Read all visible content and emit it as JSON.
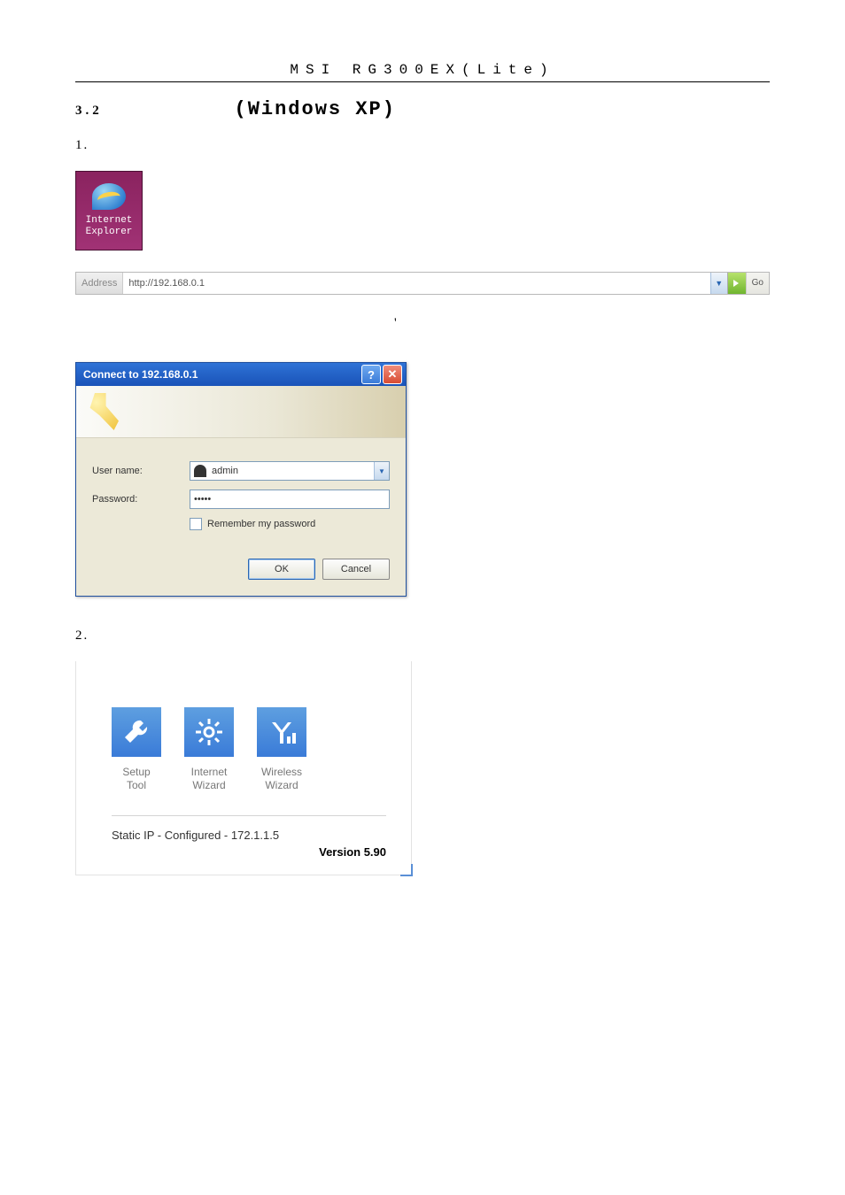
{
  "header": "MSI RG300EX(Lite)",
  "section": {
    "num": "3.2",
    "title": "(Windows XP)"
  },
  "step1": {
    "num": "1.",
    "ie_line1": "Internet",
    "ie_line2": "Explorer"
  },
  "addr": {
    "label": "Address",
    "url": "http://192.168.0.1",
    "go": "Go"
  },
  "dlg": {
    "title": "Connect to 192.168.0.1",
    "user_lbl": "User name:",
    "pass_lbl": "Password:",
    "user_val": "admin",
    "pass_val": "•••••",
    "remember": "Remember my password",
    "ok": "OK",
    "cancel": "Cancel"
  },
  "step2": {
    "num": "2."
  },
  "wiz": {
    "setup": "Setup\nTool",
    "internet": "Internet\nWizard",
    "wireless": "Wireless\nWizard",
    "status": "Static IP - Configured - 172.1.1.5",
    "version": "Version 5.90"
  }
}
